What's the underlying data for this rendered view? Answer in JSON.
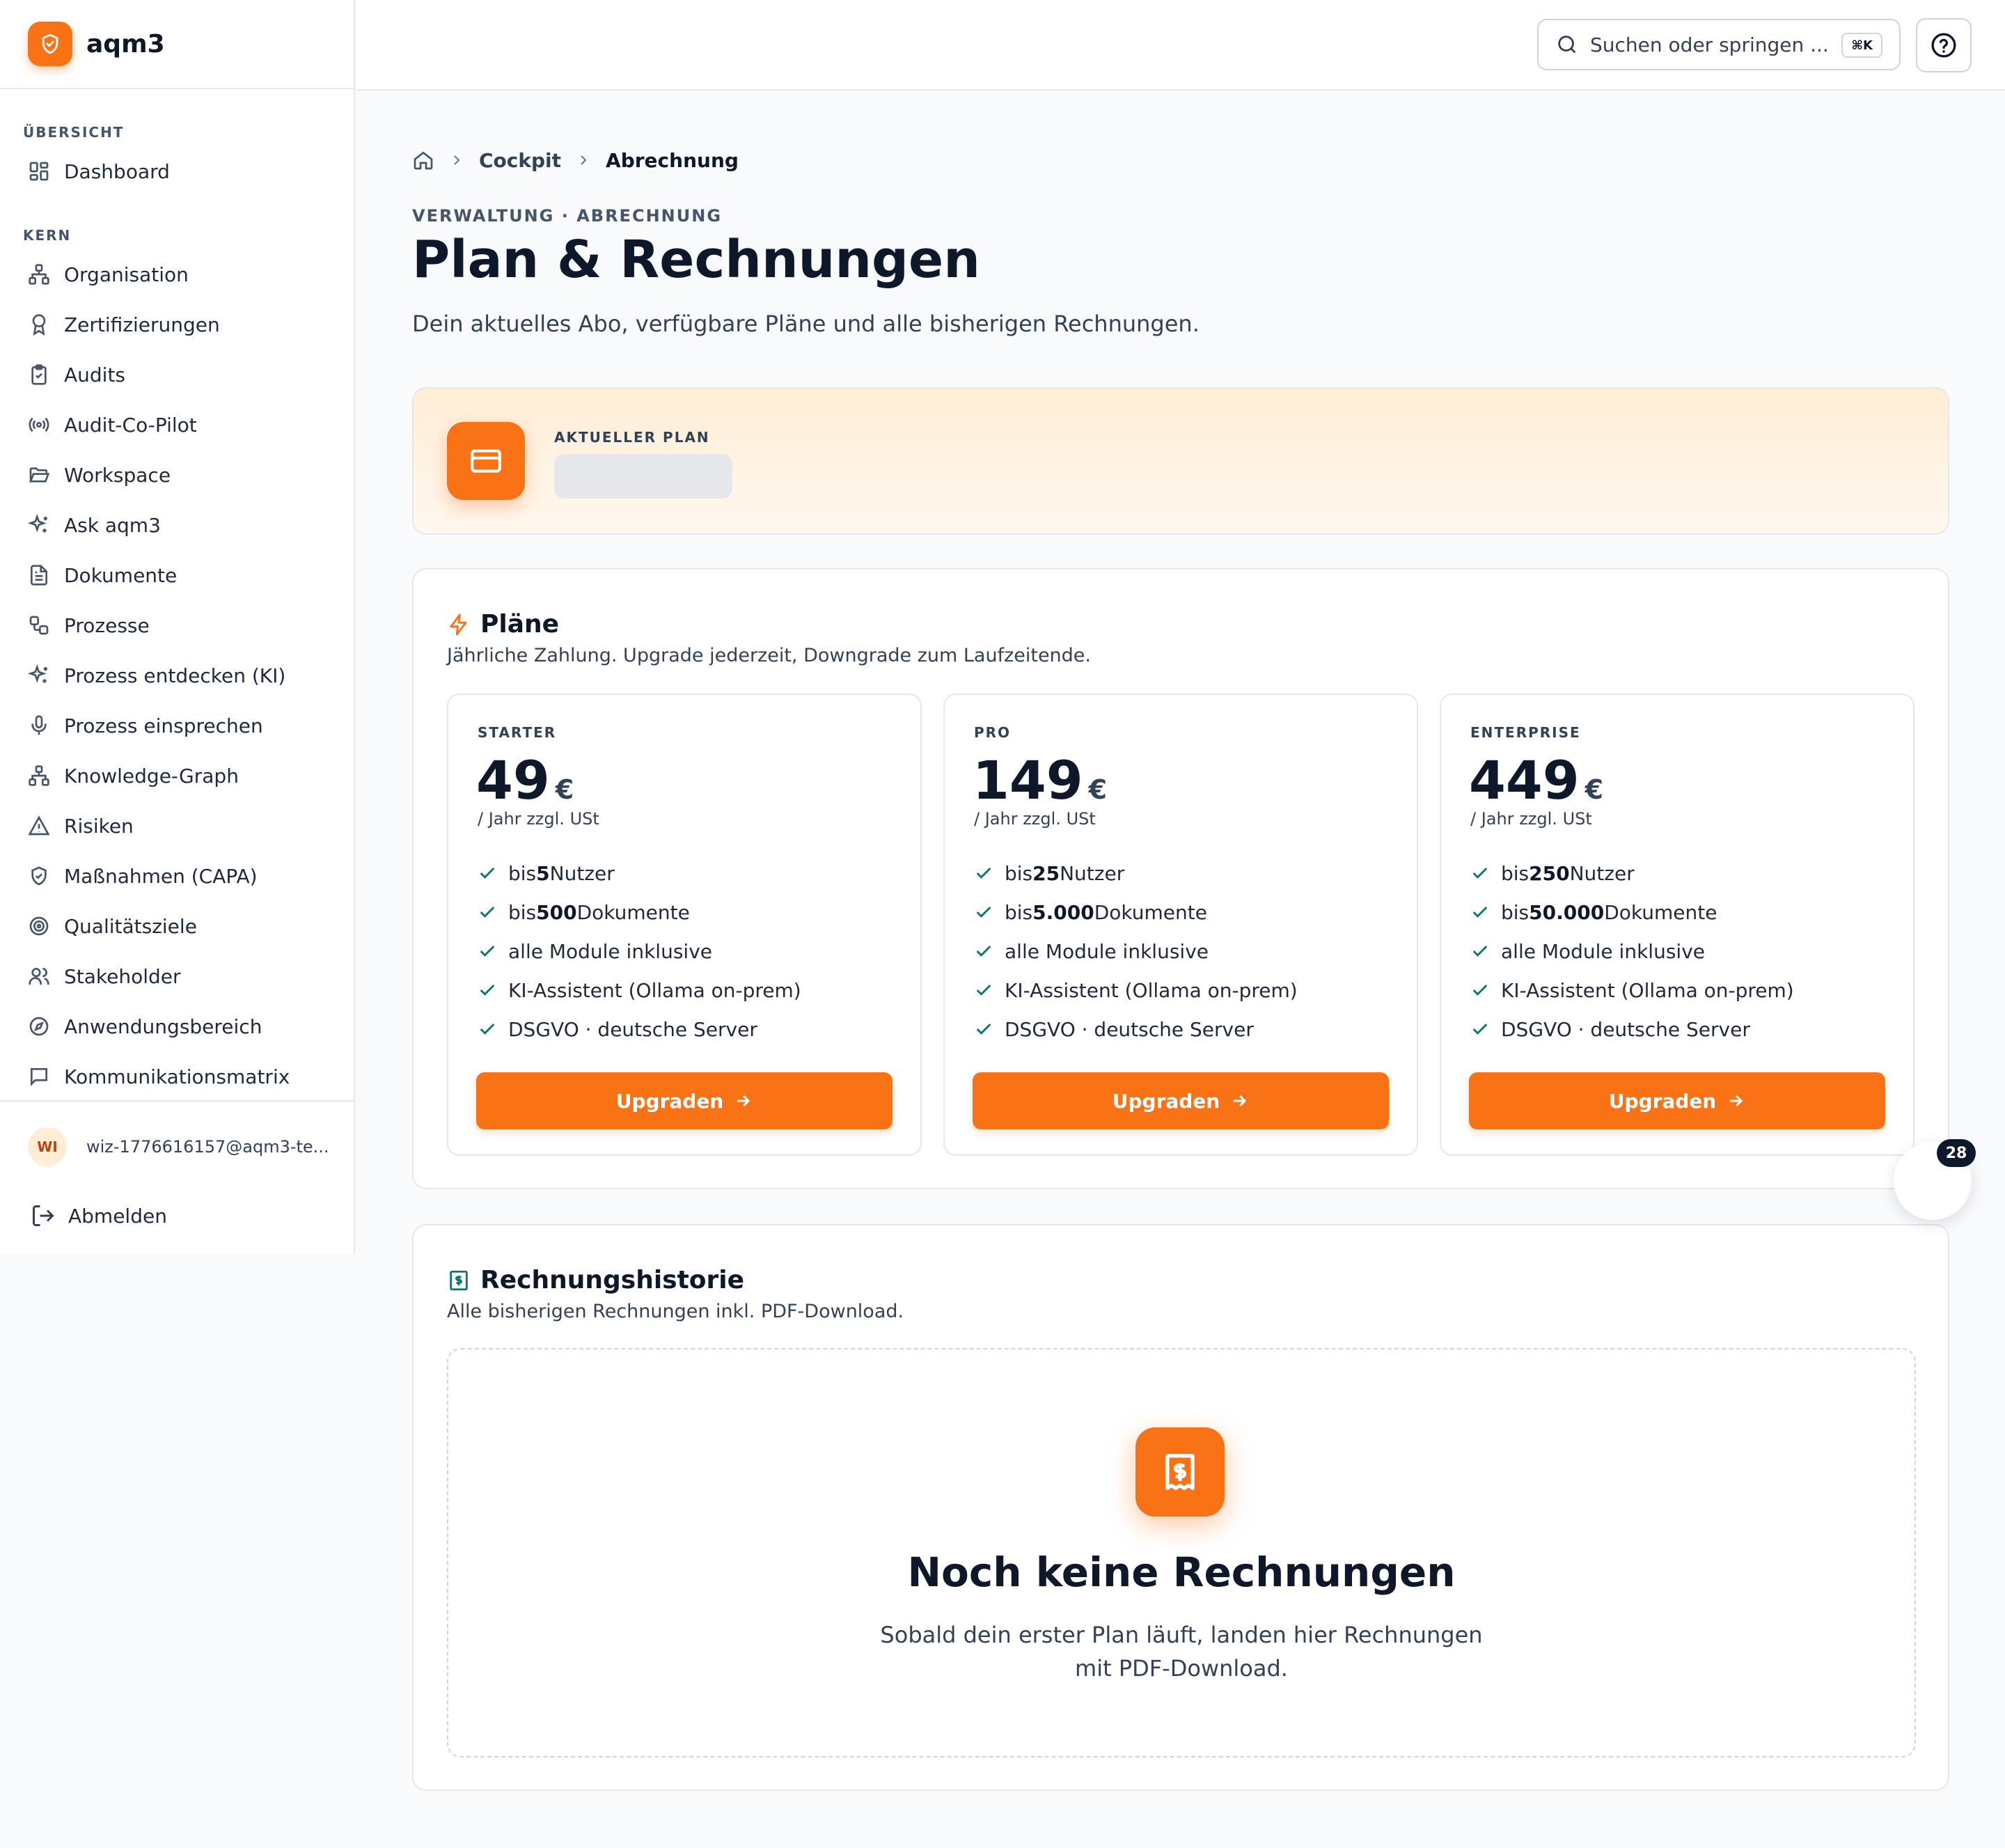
{
  "app": {
    "name": "aqm3"
  },
  "sidebar": {
    "sections": [
      {
        "label": "ÜBERSICHT",
        "items": [
          {
            "label": "Dashboard",
            "icon": "dashboard-icon"
          }
        ]
      },
      {
        "label": "KERN",
        "items": [
          {
            "label": "Organisation",
            "icon": "org-chart-icon"
          },
          {
            "label": "Zertifizierungen",
            "icon": "award-icon"
          },
          {
            "label": "Audits",
            "icon": "clipboard-check-icon"
          },
          {
            "label": "Audit-Co-Pilot",
            "icon": "radio-icon"
          },
          {
            "label": "Workspace",
            "icon": "folder-open-icon"
          },
          {
            "label": "Ask aqm3",
            "icon": "sparkles-icon"
          },
          {
            "label": "Dokumente",
            "icon": "file-text-icon"
          },
          {
            "label": "Prozesse",
            "icon": "workflow-icon"
          },
          {
            "label": "Prozess entdecken (KI)",
            "icon": "sparkles-icon"
          },
          {
            "label": "Prozess einsprechen",
            "icon": "microphone-icon"
          },
          {
            "label": "Knowledge-Graph",
            "icon": "network-icon"
          },
          {
            "label": "Risiken",
            "icon": "warning-icon"
          },
          {
            "label": "Maßnahmen (CAPA)",
            "icon": "shield-check-icon"
          },
          {
            "label": "Qualitätsziele",
            "icon": "target-icon"
          },
          {
            "label": "Stakeholder",
            "icon": "users-icon"
          },
          {
            "label": "Anwendungsbereich",
            "icon": "compass-icon"
          },
          {
            "label": "Kommunikationsmatrix",
            "icon": "message-square-icon"
          }
        ]
      }
    ],
    "user": {
      "initials": "WI",
      "email": "wiz-1776616157@aqm3-te..."
    },
    "logout_label": "Abmelden"
  },
  "topbar": {
    "search_placeholder": "Suchen oder springen ...",
    "search_shortcut": "⌘K"
  },
  "breadcrumb": {
    "link": "Cockpit",
    "current": "Abrechnung"
  },
  "page": {
    "eyebrow": "VERWALTUNG · ABRECHNUNG",
    "title": "Plan & Rechnungen",
    "subtitle": "Dein aktuelles Abo, verfügbare Pläne und alle bisherigen Rechnungen."
  },
  "current_plan": {
    "label": "AKTUELLER PLAN"
  },
  "plans": {
    "title": "Pläne",
    "description": "Jährliche Zahlung. Upgrade jederzeit, Downgrade zum Laufzeitende.",
    "items": [
      {
        "tier": "STARTER",
        "price": "49",
        "currency": "€",
        "period": "/ Jahr zzgl. USt",
        "features": [
          {
            "pre": "bis ",
            "bold": "5",
            "post": " Nutzer"
          },
          {
            "pre": "bis ",
            "bold": "500",
            "post": " Dokumente"
          },
          {
            "pre": "alle Module inklusive",
            "bold": "",
            "post": ""
          },
          {
            "pre": "KI-Assistent (Ollama on-prem)",
            "bold": "",
            "post": ""
          },
          {
            "pre": "DSGVO · deutsche Server",
            "bold": "",
            "post": ""
          }
        ],
        "button_label": "Upgraden"
      },
      {
        "tier": "PRO",
        "price": "149",
        "currency": "€",
        "period": "/ Jahr zzgl. USt",
        "features": [
          {
            "pre": "bis ",
            "bold": "25",
            "post": " Nutzer"
          },
          {
            "pre": "bis ",
            "bold": "5.000",
            "post": " Dokumente"
          },
          {
            "pre": "alle Module inklusive",
            "bold": "",
            "post": ""
          },
          {
            "pre": "KI-Assistent (Ollama on-prem)",
            "bold": "",
            "post": ""
          },
          {
            "pre": "DSGVO · deutsche Server",
            "bold": "",
            "post": ""
          }
        ],
        "button_label": "Upgraden"
      },
      {
        "tier": "ENTERPRISE",
        "price": "449",
        "currency": "€",
        "period": "/ Jahr zzgl. USt",
        "features": [
          {
            "pre": "bis ",
            "bold": "250",
            "post": " Nutzer"
          },
          {
            "pre": "bis ",
            "bold": "50.000",
            "post": " Dokumente"
          },
          {
            "pre": "alle Module inklusive",
            "bold": "",
            "post": ""
          },
          {
            "pre": "KI-Assistent (Ollama on-prem)",
            "bold": "",
            "post": ""
          },
          {
            "pre": "DSGVO · deutsche Server",
            "bold": "",
            "post": ""
          }
        ],
        "button_label": "Upgraden"
      }
    ]
  },
  "invoices": {
    "title": "Rechnungshistorie",
    "description": "Alle bisherigen Rechnungen inkl. PDF-Download.",
    "empty_title": "Noch keine Rechnungen",
    "empty_desc_line1": "Sobald dein erster Plan läuft, landen hier Rechnungen",
    "empty_desc_line2": "mit PDF-Download."
  },
  "floating_widget": {
    "badge": "28"
  },
  "colors": {
    "accent": "#f97316",
    "check": "#0f766e",
    "text": "#0f172a"
  }
}
